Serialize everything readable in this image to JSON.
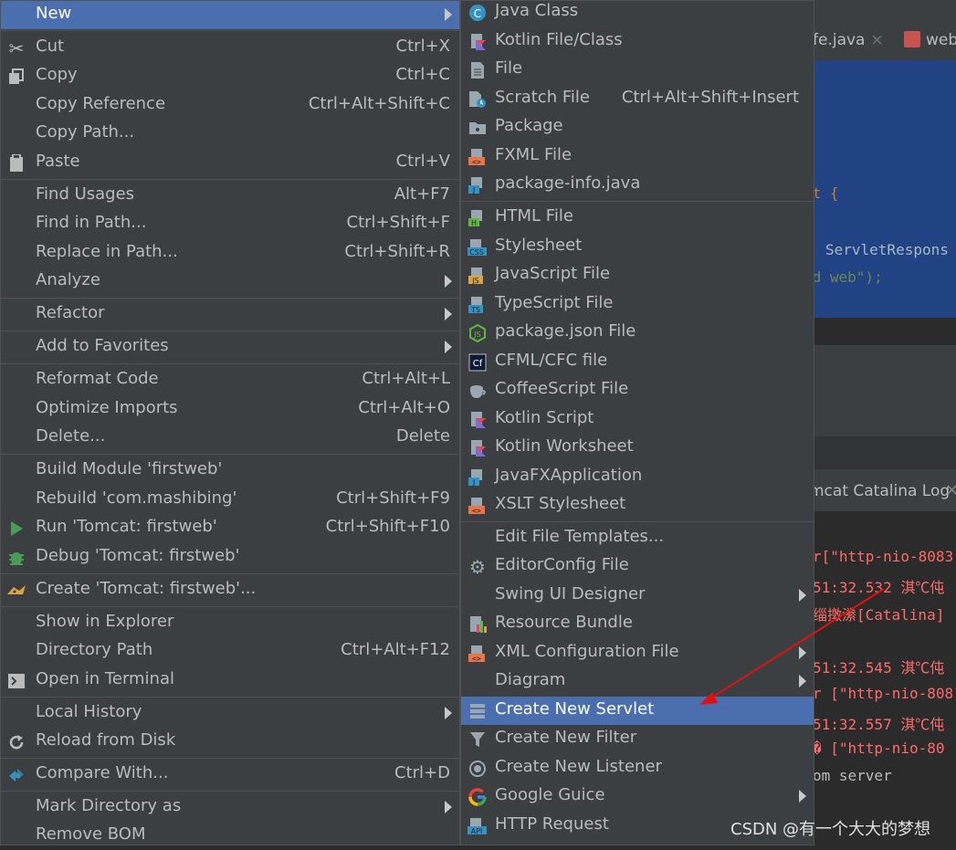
{
  "background": {
    "tabs": [
      {
        "label": "fe.java",
        "close": "×"
      },
      {
        "label": "web",
        "close": ""
      }
    ],
    "code_lines": [
      {
        "text": "et {",
        "color": "#cc7832"
      },
      {
        "text": "ServletRespons",
        "color": "#a9b7c6"
      },
      {
        "text": "nd web\");",
        "color": "#6a8759"
      }
    ],
    "log_tab": "mcat Catalina Log",
    "log_lines": [
      "r[\"http-nio-8083",
      "51:32.532 淇℃伅",
      "缁撴潫[Catalina]",
      "51:32.545 淇℃伅",
      "r [\"http-nio-808",
      "51:32.557 淇℃伅",
      "� [\"http-nio-80"
    ],
    "log_plain": "om server",
    "watermark": "CSDN @有一个大大的梦想"
  },
  "left_menu": {
    "items": [
      {
        "label": "New",
        "shortcut": "",
        "submenu": true,
        "selected": true,
        "icon": "none"
      },
      {
        "label": "Cut",
        "shortcut": "Ctrl+X",
        "submenu": false,
        "icon": "scissors-icon"
      },
      {
        "label": "Copy",
        "shortcut": "Ctrl+C",
        "submenu": false,
        "icon": "copy-icon"
      },
      {
        "label": "Copy Reference",
        "shortcut": "Ctrl+Alt+Shift+C",
        "submenu": false,
        "icon": "none"
      },
      {
        "label": "Copy Path...",
        "shortcut": "",
        "submenu": false,
        "icon": "none"
      },
      {
        "label": "Paste",
        "shortcut": "Ctrl+V",
        "submenu": false,
        "icon": "clipboard-icon"
      },
      {
        "label": "Find Usages",
        "shortcut": "Alt+F7",
        "submenu": false,
        "icon": "none"
      },
      {
        "label": "Find in Path...",
        "shortcut": "Ctrl+Shift+F",
        "submenu": false,
        "icon": "none"
      },
      {
        "label": "Replace in Path...",
        "shortcut": "Ctrl+Shift+R",
        "submenu": false,
        "icon": "none"
      },
      {
        "label": "Analyze",
        "shortcut": "",
        "submenu": true,
        "icon": "none"
      },
      {
        "label": "Refactor",
        "shortcut": "",
        "submenu": true,
        "icon": "none"
      },
      {
        "label": "Add to Favorites",
        "shortcut": "",
        "submenu": true,
        "icon": "none"
      },
      {
        "label": "Reformat Code",
        "shortcut": "Ctrl+Alt+L",
        "submenu": false,
        "icon": "none"
      },
      {
        "label": "Optimize Imports",
        "shortcut": "Ctrl+Alt+O",
        "submenu": false,
        "icon": "none"
      },
      {
        "label": "Delete...",
        "shortcut": "Delete",
        "submenu": false,
        "icon": "none"
      },
      {
        "label": "Build Module 'firstweb'",
        "shortcut": "",
        "submenu": false,
        "icon": "none"
      },
      {
        "label": "Rebuild 'com.mashibing'",
        "shortcut": "Ctrl+Shift+F9",
        "submenu": false,
        "icon": "none"
      },
      {
        "label": "Run 'Tomcat: firstweb'",
        "shortcut": "Ctrl+Shift+F10",
        "submenu": false,
        "icon": "run-icon"
      },
      {
        "label": "Debug 'Tomcat: firstweb'",
        "shortcut": "",
        "submenu": false,
        "icon": "debug-icon"
      },
      {
        "label": "Create 'Tomcat: firstweb'...",
        "shortcut": "",
        "submenu": false,
        "icon": "tomcat-icon"
      },
      {
        "label": "Show in Explorer",
        "shortcut": "",
        "submenu": false,
        "icon": "none"
      },
      {
        "label": "Directory Path",
        "shortcut": "Ctrl+Alt+F12",
        "submenu": false,
        "icon": "none"
      },
      {
        "label": "Open in Terminal",
        "shortcut": "",
        "submenu": false,
        "icon": "terminal-icon"
      },
      {
        "label": "Local History",
        "shortcut": "",
        "submenu": true,
        "icon": "none"
      },
      {
        "label": "Reload from Disk",
        "shortcut": "",
        "submenu": false,
        "icon": "reload-icon"
      },
      {
        "label": "Compare With...",
        "shortcut": "Ctrl+D",
        "submenu": false,
        "icon": "compare-icon"
      },
      {
        "label": "Mark Directory as",
        "shortcut": "",
        "submenu": true,
        "icon": "none"
      },
      {
        "label": "Remove BOM",
        "shortcut": "",
        "submenu": false,
        "icon": "none"
      }
    ]
  },
  "right_menu": {
    "items": [
      {
        "label": "Java Class",
        "shortcut": "",
        "submenu": false,
        "icon": "java-class-icon"
      },
      {
        "label": "Kotlin File/Class",
        "shortcut": "",
        "submenu": false,
        "icon": "kotlin-file-icon"
      },
      {
        "label": "File",
        "shortcut": "",
        "submenu": false,
        "icon": "file-icon"
      },
      {
        "label": "Scratch File",
        "shortcut": "Ctrl+Alt+Shift+Insert",
        "submenu": false,
        "icon": "scratch-file-icon"
      },
      {
        "label": "Package",
        "shortcut": "",
        "submenu": false,
        "icon": "package-icon"
      },
      {
        "label": "FXML File",
        "shortcut": "",
        "submenu": false,
        "icon": "fxml-file-icon"
      },
      {
        "label": "package-info.java",
        "shortcut": "",
        "submenu": false,
        "icon": "package-info-icon"
      },
      {
        "label": "HTML File",
        "shortcut": "",
        "submenu": false,
        "icon": "html-file-icon"
      },
      {
        "label": "Stylesheet",
        "shortcut": "",
        "submenu": false,
        "icon": "css-file-icon"
      },
      {
        "label": "JavaScript File",
        "shortcut": "",
        "submenu": false,
        "icon": "js-file-icon"
      },
      {
        "label": "TypeScript File",
        "shortcut": "",
        "submenu": false,
        "icon": "ts-file-icon"
      },
      {
        "label": "package.json File",
        "shortcut": "",
        "submenu": false,
        "icon": "nodejs-icon"
      },
      {
        "label": "CFML/CFC file",
        "shortcut": "",
        "submenu": false,
        "icon": "cfml-icon"
      },
      {
        "label": "CoffeeScript File",
        "shortcut": "",
        "submenu": false,
        "icon": "coffee-icon"
      },
      {
        "label": "Kotlin Script",
        "shortcut": "",
        "submenu": false,
        "icon": "kotlin-script-icon"
      },
      {
        "label": "Kotlin Worksheet",
        "shortcut": "",
        "submenu": false,
        "icon": "kotlin-worksheet-icon"
      },
      {
        "label": "JavaFXApplication",
        "shortcut": "",
        "submenu": false,
        "icon": "javafx-icon"
      },
      {
        "label": "XSLT Stylesheet",
        "shortcut": "",
        "submenu": false,
        "icon": "xslt-icon"
      },
      {
        "label": "Edit File Templates...",
        "shortcut": "",
        "submenu": false,
        "icon": "none"
      },
      {
        "label": "EditorConfig File",
        "shortcut": "",
        "submenu": false,
        "icon": "gear-icon"
      },
      {
        "label": "Swing UI Designer",
        "shortcut": "",
        "submenu": true,
        "icon": "none"
      },
      {
        "label": "Resource Bundle",
        "shortcut": "",
        "submenu": false,
        "icon": "resource-bundle-icon"
      },
      {
        "label": "XML Configuration File",
        "shortcut": "",
        "submenu": true,
        "icon": "xml-icon"
      },
      {
        "label": "Diagram",
        "shortcut": "",
        "submenu": true,
        "icon": "none"
      },
      {
        "label": "Create New Servlet",
        "shortcut": "",
        "submenu": false,
        "selected": true,
        "icon": "servlet-icon"
      },
      {
        "label": "Create New Filter",
        "shortcut": "",
        "submenu": false,
        "icon": "filter-icon"
      },
      {
        "label": "Create New Listener",
        "shortcut": "",
        "submenu": false,
        "icon": "listener-icon"
      },
      {
        "label": "Google Guice",
        "shortcut": "",
        "submenu": true,
        "icon": "google-icon"
      },
      {
        "label": "HTTP Request",
        "shortcut": "",
        "submenu": false,
        "icon": "api-icon"
      }
    ]
  },
  "colors": {
    "menu_bg": "#3c3f41",
    "selection": "#4b6eaf",
    "text": "#bbbbbb",
    "annotation_arrow": "#e01010"
  }
}
